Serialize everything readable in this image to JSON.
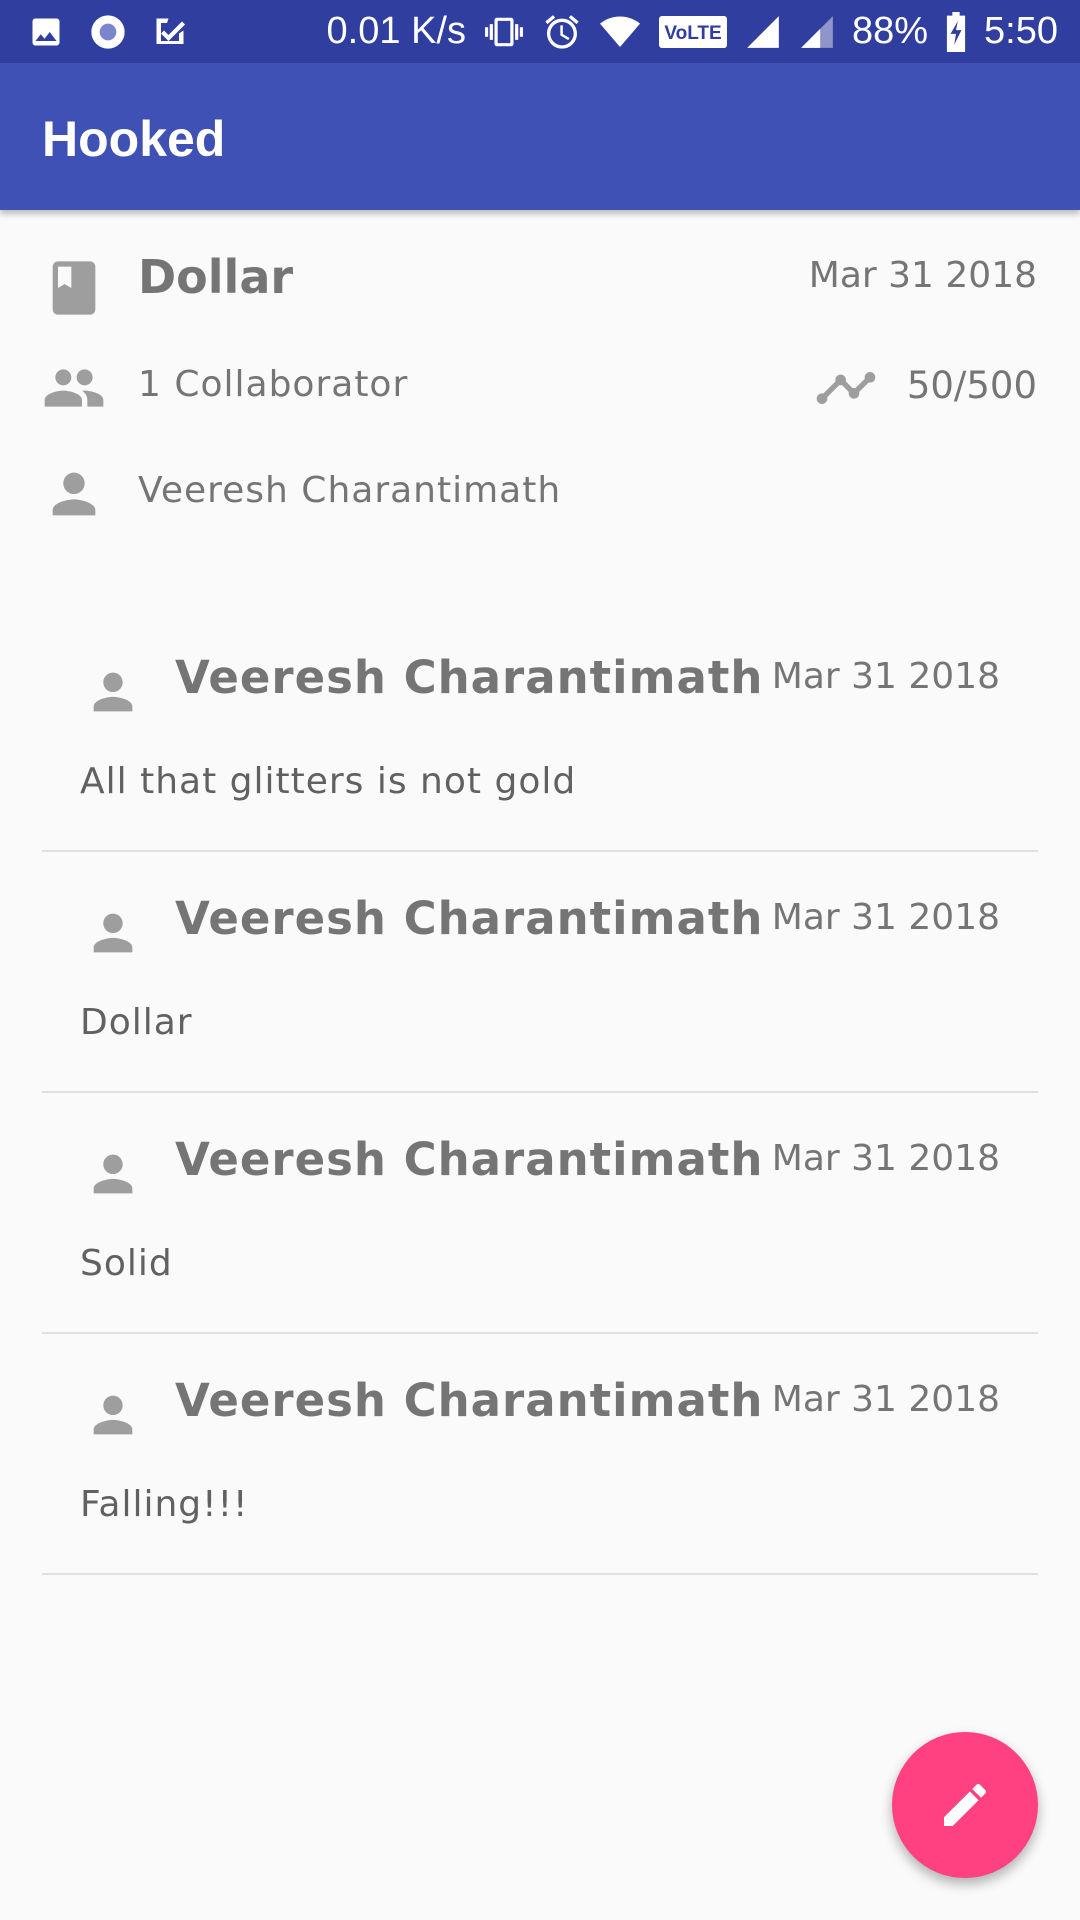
{
  "status_bar": {
    "net_speed": "0.01 K/s",
    "volte": "VoLTE",
    "battery": "88%",
    "time": "5:50",
    "icons": [
      "image-icon",
      "circle-app-icon",
      "check-app-icon",
      "vibrate-icon",
      "alarm-icon",
      "wifi-icon",
      "signal-icon",
      "signal-icon",
      "battery-charging-icon"
    ]
  },
  "app_bar": {
    "title": "Hooked"
  },
  "book": {
    "title": "Dollar",
    "date": "Mar 31 2018",
    "collaborators": "1 Collaborator",
    "progress": "50/500",
    "owner": "Veeresh Charantimath",
    "icons": {
      "book": "book-icon",
      "group": "people-icon",
      "trend": "trend-icon",
      "person": "person-icon"
    }
  },
  "entries": [
    {
      "author": "Veeresh Charantimath",
      "date": "Mar 31 2018",
      "text": "All that glitters is not gold"
    },
    {
      "author": "Veeresh Charantimath",
      "date": "Mar 31 2018",
      "text": "Dollar"
    },
    {
      "author": "Veeresh Charantimath",
      "date": "Mar 31 2018",
      "text": "Solid"
    },
    {
      "author": "Veeresh Charantimath",
      "date": "Mar 31 2018",
      "text": "Falling!!!"
    }
  ],
  "fab": {
    "icon": "pencil-icon"
  },
  "colors": {
    "status_bar": "#303f9f",
    "app_bar": "#3f51b5",
    "fab": "#ff4081",
    "icon_gray": "#9e9e9e",
    "text_gray": "#757575"
  }
}
